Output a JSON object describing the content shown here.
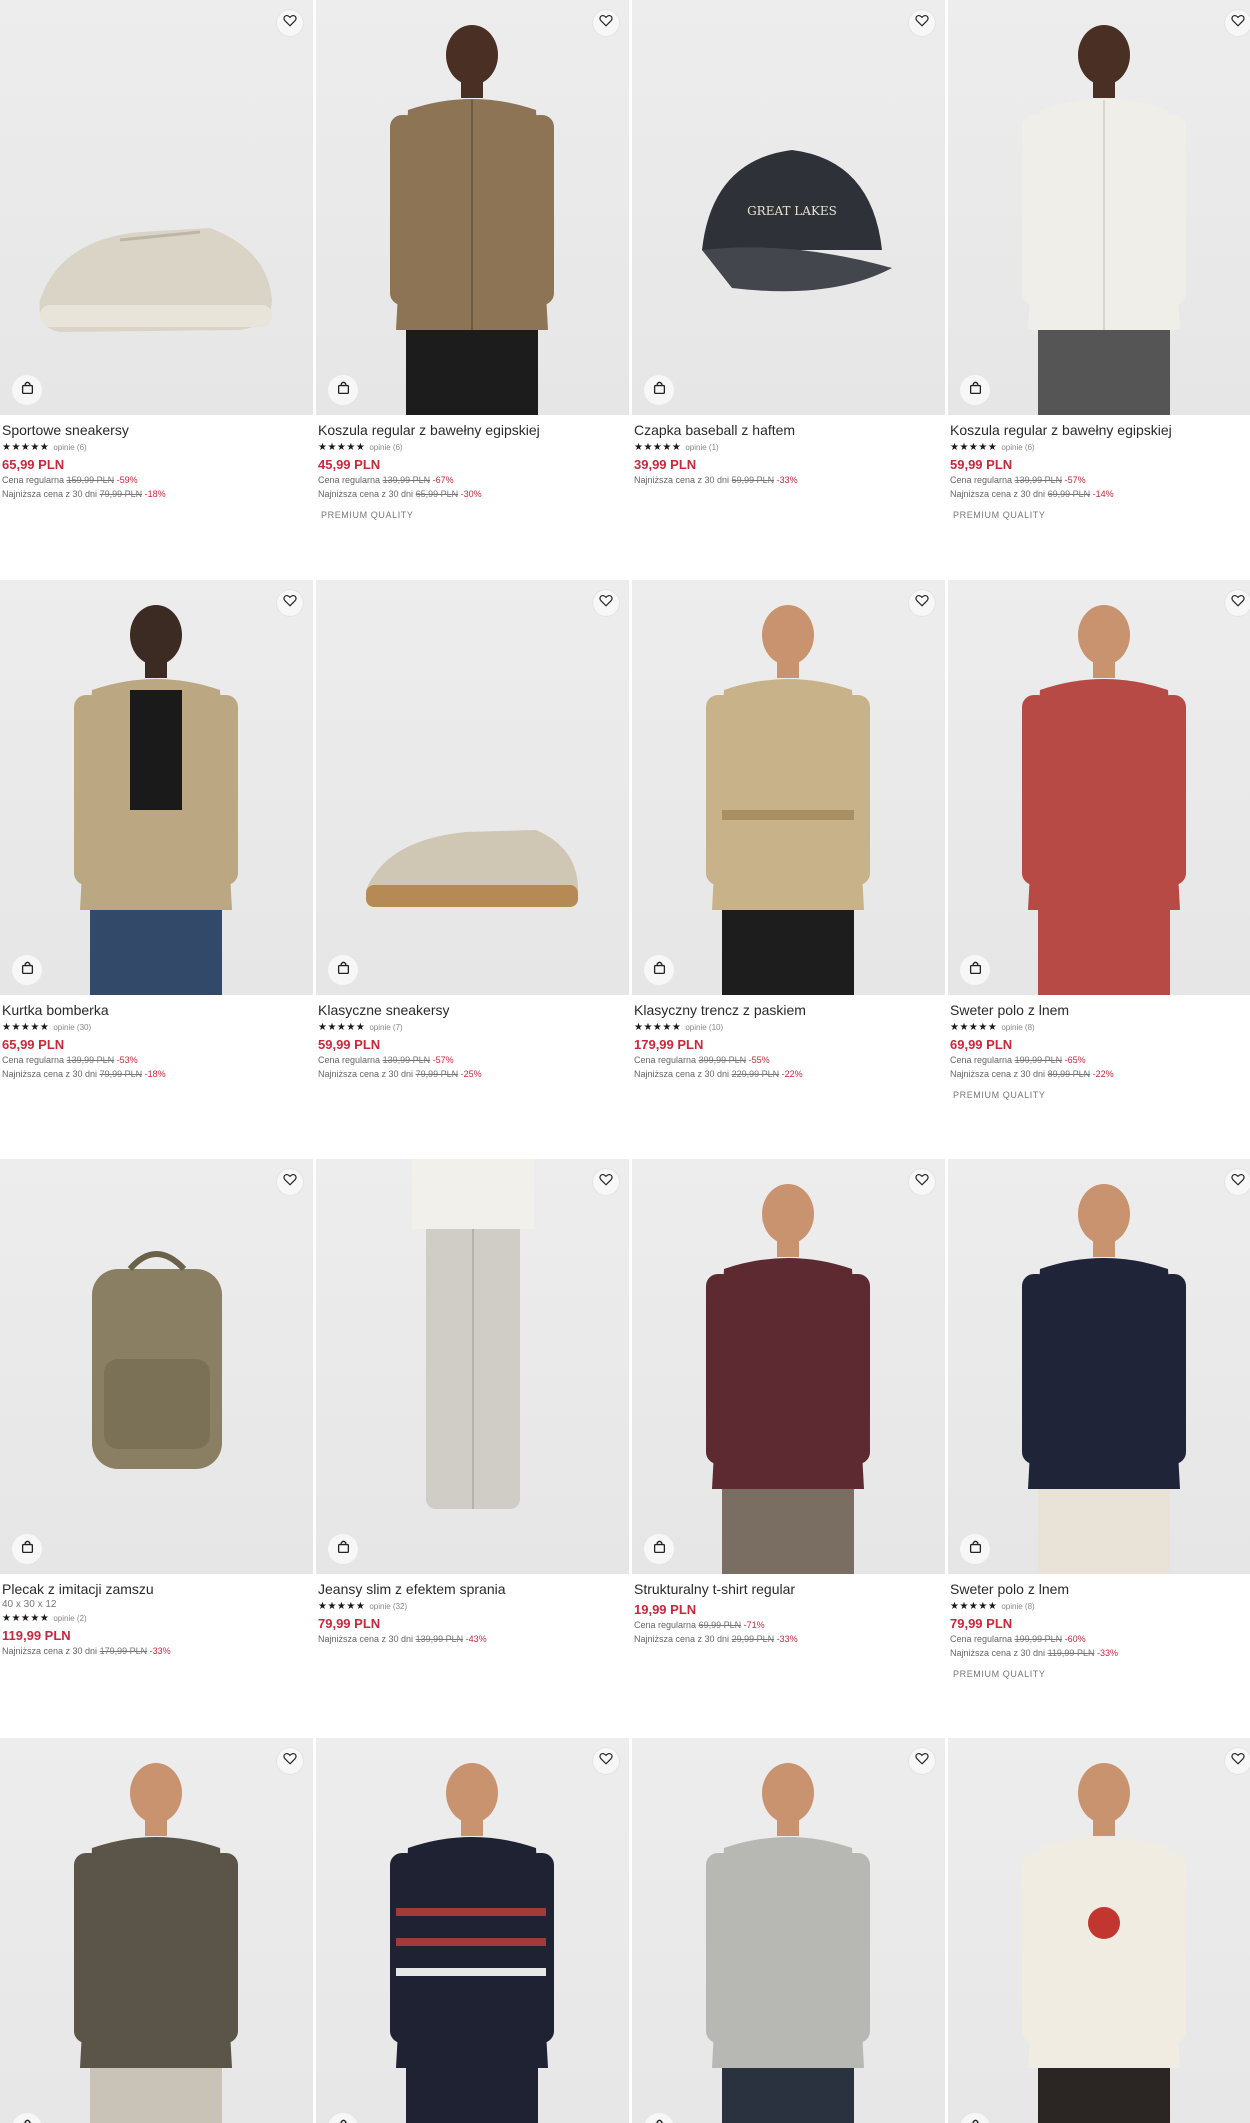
{
  "colors": {
    "price": "#c8283a",
    "discount": "#c8283a",
    "text": "#2a2a2a"
  },
  "icons": {
    "favorite": "heart-icon",
    "add_to_bag": "shopping-bag-icon"
  },
  "products": [
    {
      "name": "Sportowe sneakersy",
      "stars": "★★★★★",
      "rating": 4.5,
      "reviews": "opinie (6)",
      "price": "65,99 PLN",
      "regular_label": "Cena regularna",
      "regular_price": "159,99 PLN",
      "regular_pct": "-59%",
      "lowest_label": "Najniższa cena z 30 dni",
      "lowest_price": "79,99 PLN",
      "lowest_pct": "-18%",
      "badge": ""
    },
    {
      "name": "Koszula regular z bawełny egipskiej",
      "stars": "★★★★★",
      "rating": 5,
      "reviews": "opinie (6)",
      "price": "45,99 PLN",
      "regular_label": "Cena regularna",
      "regular_price": "139,99 PLN",
      "regular_pct": "-67%",
      "lowest_label": "Najniższa cena z 30 dni",
      "lowest_price": "65,99 PLN",
      "lowest_pct": "-30%",
      "badge": "PREMIUM QUALITY"
    },
    {
      "name": "Czapka baseball z haftem",
      "stars": "★★★★★",
      "rating": 5,
      "reviews": "opinie (1)",
      "price": "39,99 PLN",
      "regular_label": "",
      "regular_price": "",
      "regular_pct": "",
      "lowest_label": "Najniższa cena z 30 dni",
      "lowest_price": "59,99 PLN",
      "lowest_pct": "-33%",
      "badge": ""
    },
    {
      "name": "Koszula regular z bawełny egipskiej",
      "stars": "★★★★★",
      "rating": 5,
      "reviews": "opinie (6)",
      "price": "59,99 PLN",
      "regular_label": "Cena regularna",
      "regular_price": "139,99 PLN",
      "regular_pct": "-57%",
      "lowest_label": "Najniższa cena z 30 dni",
      "lowest_price": "69,99 PLN",
      "lowest_pct": "-14%",
      "badge": "PREMIUM QUALITY"
    },
    {
      "name": "Kurtka bomberka",
      "stars": "★★★★★",
      "rating": 5,
      "reviews": "opinie (30)",
      "price": "65,99 PLN",
      "regular_label": "Cena regularna",
      "regular_price": "139,99 PLN",
      "regular_pct": "-53%",
      "lowest_label": "Najniższa cena z 30 dni",
      "lowest_price": "79,99 PLN",
      "lowest_pct": "-18%",
      "badge": ""
    },
    {
      "name": "Klasyczne sneakersy",
      "stars": "★★★★★",
      "rating": 5,
      "reviews": "opinie (7)",
      "price": "59,99 PLN",
      "regular_label": "Cena regularna",
      "regular_price": "139,99 PLN",
      "regular_pct": "-57%",
      "lowest_label": "Najniższa cena z 30 dni",
      "lowest_price": "79,99 PLN",
      "lowest_pct": "-25%",
      "badge": ""
    },
    {
      "name": "Klasyczny trencz z paskiem",
      "stars": "★★★★★",
      "rating": 5,
      "reviews": "opinie (10)",
      "price": "179,99 PLN",
      "regular_label": "Cena regularna",
      "regular_price": "399,99 PLN",
      "regular_pct": "-55%",
      "lowest_label": "Najniższa cena z 30 dni",
      "lowest_price": "229,99 PLN",
      "lowest_pct": "-22%",
      "badge": ""
    },
    {
      "name": "Sweter polo z lnem",
      "stars": "★★★★★",
      "rating": 5,
      "reviews": "opinie (8)",
      "price": "69,99 PLN",
      "regular_label": "Cena regularna",
      "regular_price": "199,99 PLN",
      "regular_pct": "-65%",
      "lowest_label": "Najniższa cena z 30 dni",
      "lowest_price": "89,99 PLN",
      "lowest_pct": "-22%",
      "badge": "PREMIUM QUALITY"
    },
    {
      "name": "Plecak z imitacji zamszu",
      "dims": "40 x 30 x 12",
      "stars": "★★★★★",
      "rating": 5,
      "reviews": "opinie (2)",
      "price": "119,99 PLN",
      "regular_label": "",
      "regular_price": "",
      "regular_pct": "",
      "lowest_label": "Najniższa cena z 30 dni",
      "lowest_price": "179,99 PLN",
      "lowest_pct": "-33%",
      "badge": ""
    },
    {
      "name": "Jeansy slim z efektem sprania",
      "stars": "★★★★★",
      "rating": 5,
      "reviews": "opinie (32)",
      "price": "79,99 PLN",
      "regular_label": "",
      "regular_price": "",
      "regular_pct": "",
      "lowest_label": "Najniższa cena z 30 dni",
      "lowest_price": "139,99 PLN",
      "lowest_pct": "-43%",
      "badge": ""
    },
    {
      "name": "Strukturalny t-shirt regular",
      "stars": "",
      "rating": 0,
      "reviews": "",
      "price": "19,99 PLN",
      "regular_label": "Cena regularna",
      "regular_price": "69,99 PLN",
      "regular_pct": "-71%",
      "lowest_label": "Najniższa cena z 30 dni",
      "lowest_price": "29,99 PLN",
      "lowest_pct": "-33%",
      "badge": ""
    },
    {
      "name": "Sweter polo z lnem",
      "stars": "★★★★★",
      "rating": 5,
      "reviews": "opinie (8)",
      "price": "79,99 PLN",
      "regular_label": "Cena regularna",
      "regular_price": "199,99 PLN",
      "regular_pct": "-60%",
      "lowest_label": "Najniższa cena z 30 dni",
      "lowest_price": "119,99 PLN",
      "lowest_pct": "-33%",
      "badge": "PREMIUM QUALITY"
    },
    {
      "name": "",
      "price": ""
    },
    {
      "name": "",
      "price": ""
    },
    {
      "name": "",
      "price": ""
    },
    {
      "name": "",
      "price": ""
    }
  ]
}
